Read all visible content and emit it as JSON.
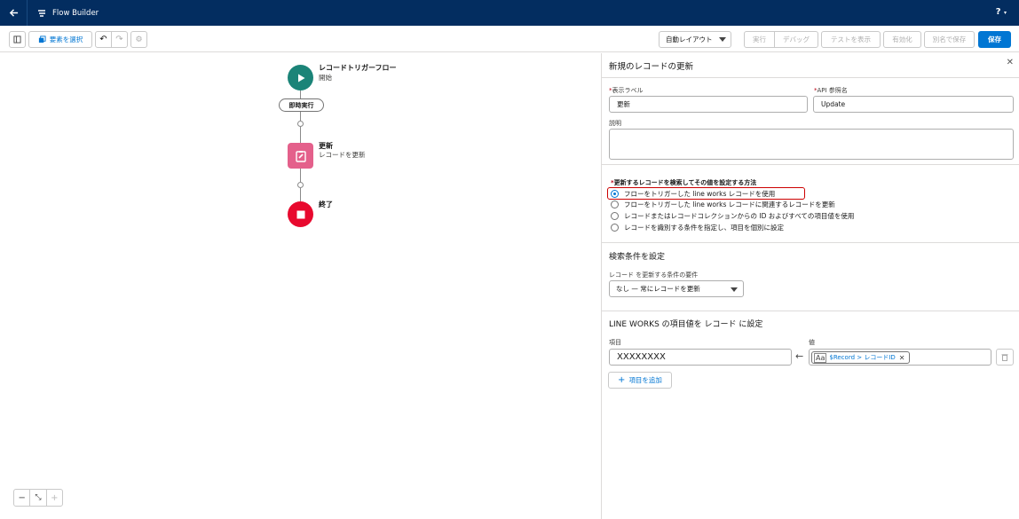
{
  "header": {
    "app_title": "Flow Builder",
    "help": "?"
  },
  "toolbar": {
    "select_elements": "要素を選択",
    "auto_layout": "自動レイアウト",
    "run": "実行",
    "debug": "デバッグ",
    "view_tests": "テストを表示",
    "activate": "有効化",
    "save_as": "別名で保存",
    "save": "保存"
  },
  "canvas": {
    "start": {
      "title": "レコードトリガーフロー",
      "subtitle": "開始"
    },
    "path_label": "即時実行",
    "update": {
      "title": "更新",
      "subtitle": "レコードを更新"
    },
    "end": {
      "title": "終了"
    }
  },
  "panel": {
    "title": "新規のレコードの更新",
    "label_field": {
      "label": "表示ラベル",
      "value": "更新"
    },
    "api_field": {
      "label": "API 参照名",
      "value": "Update"
    },
    "description_label": "説明",
    "method_label": "更新するレコードを検索してその値を設定する方法",
    "options": [
      "フローをトリガーした line works レコードを使用",
      "フローをトリガーした line works レコードに関連するレコードを更新",
      "レコードまたはレコードコレクションからの ID およびすべての項目値を使用",
      "レコードを識別する条件を指定し、項目を個別に設定"
    ],
    "filter_section": "検索条件を設定",
    "condition_label": "レコード を更新する条件の要件",
    "condition_value": "なし — 常にレコードを更新",
    "field_section": "LINE WORKS の項目値を レコード に設定",
    "field_label": "項目",
    "value_label": "値",
    "field_value": "XXXXXXXX",
    "resource_value": "$Record > レコードID",
    "add_field": "項目を追加"
  }
}
